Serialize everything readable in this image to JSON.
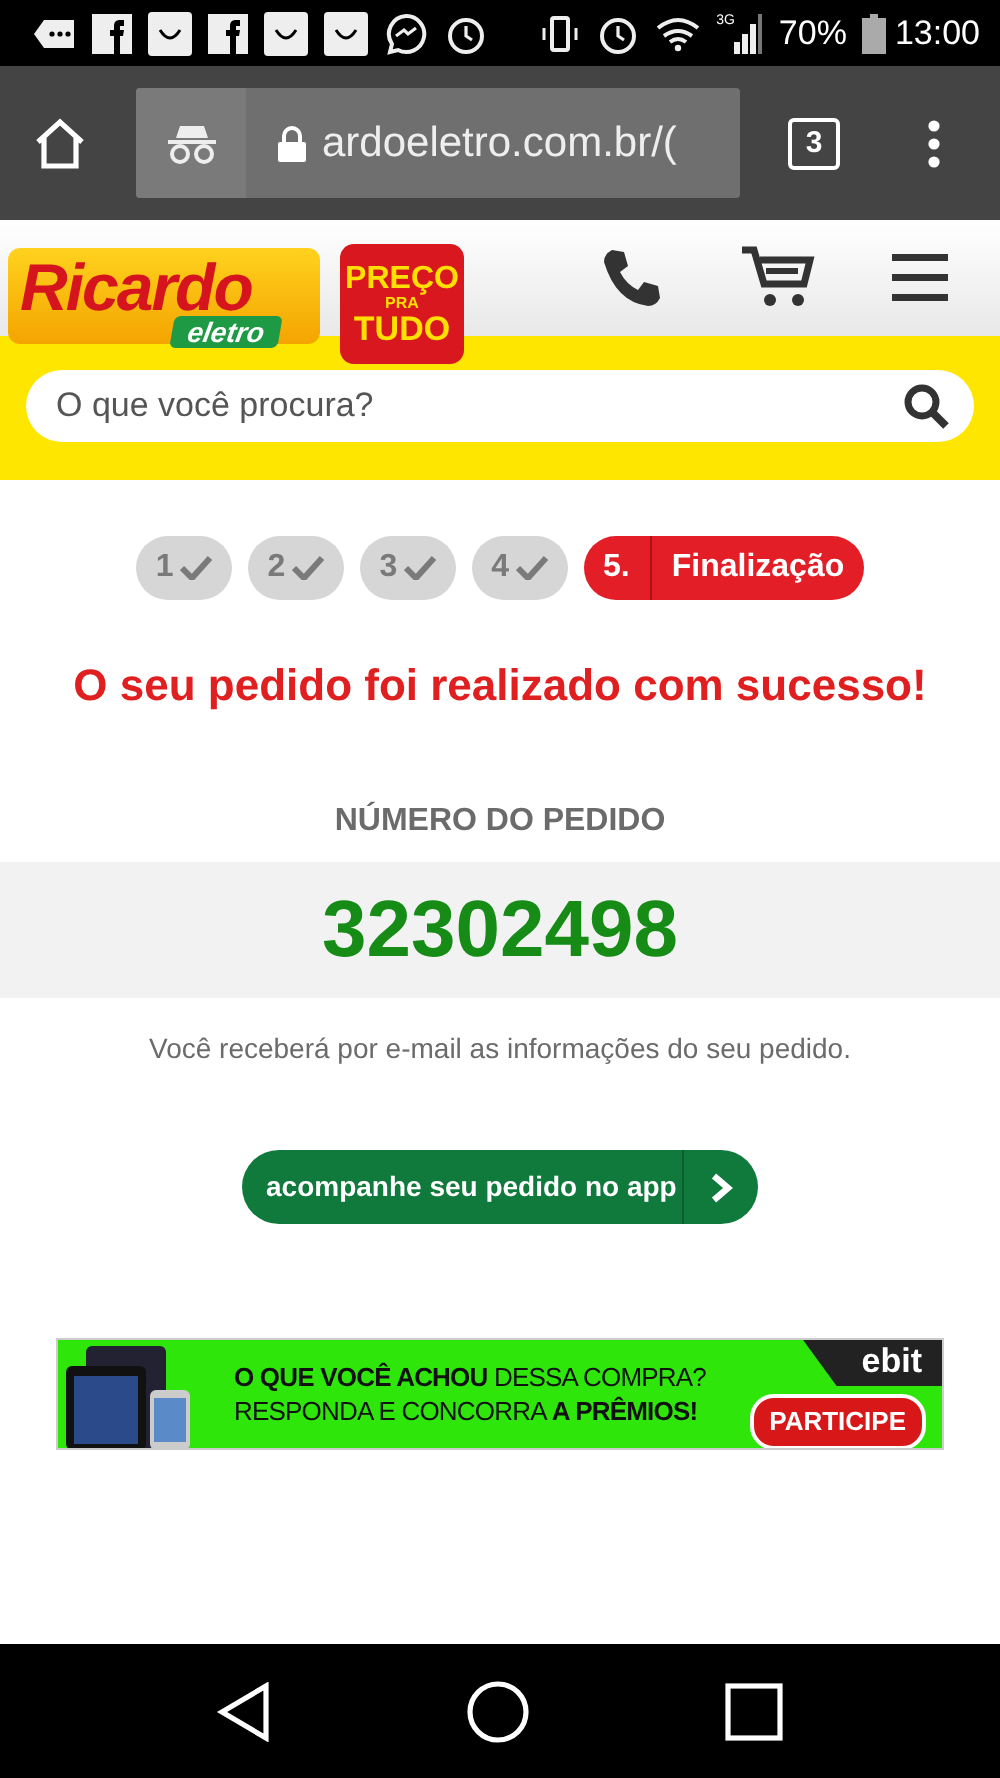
{
  "status_bar": {
    "network": "3G",
    "battery": "70%",
    "time": "13:00"
  },
  "browser": {
    "url": "ardoeletro.com.br/(",
    "tab_count": "3"
  },
  "header": {
    "logo": {
      "brand": "Ricardo",
      "sub": "eletro"
    },
    "badge": [
      "PREÇO",
      "PRA",
      "TUDO"
    ]
  },
  "search": {
    "placeholder": "O que você procura?"
  },
  "steps": [
    {
      "label": "1",
      "done": true,
      "selected": false
    },
    {
      "label": "2",
      "done": true,
      "selected": false
    },
    {
      "label": "3",
      "done": true,
      "selected": false
    },
    {
      "label": "4",
      "done": true,
      "selected": false
    },
    {
      "label": "5.",
      "title": "Finalização",
      "done": false,
      "selected": true
    }
  ],
  "success_message": "O seu pedido foi realizado com sucesso!",
  "order": {
    "label": "NÚMERO DO PEDIDO",
    "number": "32302498",
    "note": "Você receberá por e-mail as informações do seu pedido."
  },
  "app_button": "acompanhe seu pedido no app",
  "banner": {
    "line_1": "**O QUE VOCÊ ACHOU** DESSA COMPRA?",
    "line_2": "RESPONDA E CONCORRA **A PRÊMIOS!**",
    "brand": "ebit",
    "button": "PARTICIPE"
  }
}
